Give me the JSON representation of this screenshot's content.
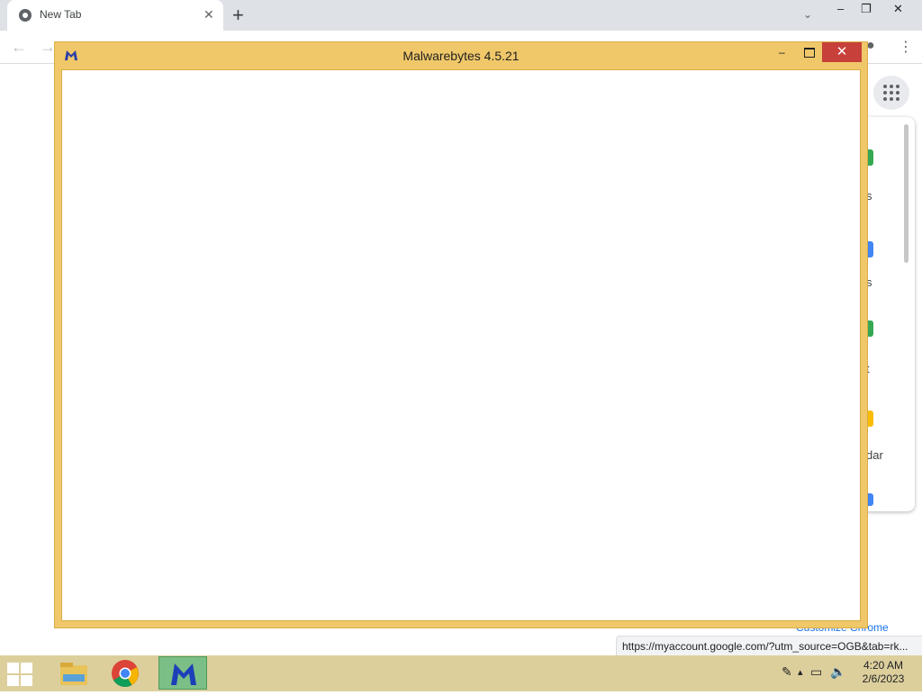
{
  "browser": {
    "tab_title": "New Tab",
    "tab_close": "✕",
    "new_tab": "+",
    "tab_search": "⌄",
    "win_min": "–",
    "win_max": "❐",
    "win_close": "✕",
    "back": "←",
    "forward": "→",
    "menu": "⋮",
    "profile": "●"
  },
  "ntp": {
    "app_label_fragments": [
      "s",
      "s",
      "t",
      "dar"
    ],
    "customize_label": "Customize Chrome",
    "status_url": "https://myaccount.google.com/?utm_source=OGB&tab=rk..."
  },
  "malwarebytes": {
    "title": "Malwarebytes 4.5.21",
    "minimize": "–",
    "close": "✕"
  },
  "taskbar": {
    "clock_time": "4:20 AM",
    "clock_date": "2/6/2023",
    "pen": "✎",
    "network": "▭",
    "volume": "🔈",
    "chevron": "▴"
  },
  "colors": {
    "mb_frame": "#f0c86a",
    "mb_close": "#c7403a",
    "taskbar": "#dccf9c",
    "taskbar_active": "#7bbf86"
  }
}
